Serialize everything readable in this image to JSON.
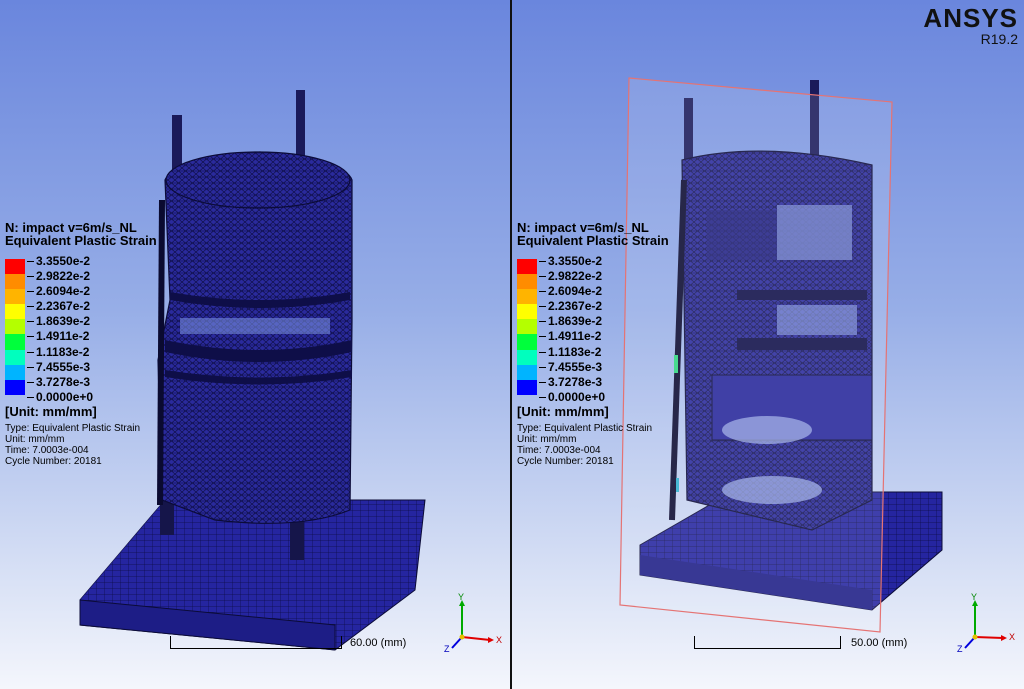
{
  "left_view": {
    "title": "N: impact v=6m/s_NL",
    "subtitle": "Equivalent Plastic Strain",
    "unit": "[Unit: mm/mm]",
    "info": [
      "Type: Equivalent Plastic Strain",
      "Unit: mm/mm",
      "Time: 7.0003e-004",
      "Cycle Number: 20181"
    ],
    "scale_label": "60.00  (mm)"
  },
  "right_view": {
    "title": "N: impact v=6m/s_NL",
    "subtitle": "Equivalent Plastic Strain",
    "unit": "[Unit: mm/mm]",
    "info": [
      "Type: Equivalent Plastic Strain",
      "Unit: mm/mm",
      "Time: 7.0003e-004",
      "Cycle Number: 20181"
    ],
    "scale_label": "50.00  (mm)"
  },
  "legend_values": [
    "3.3550e-2",
    "2.9822e-2",
    "2.6094e-2",
    "2.2367e-2",
    "1.8639e-2",
    "1.4911e-2",
    "1.1183e-2",
    "7.4555e-3",
    "3.7278e-3",
    "0.0000e+0"
  ],
  "legend_colors": [
    "#ff0000",
    "#ff8c00",
    "#ffb400",
    "#ffff00",
    "#b4ff00",
    "#00ff3c",
    "#00ffbe",
    "#00b4ff",
    "#0000ff"
  ],
  "triad": {
    "x": "X",
    "y": "Y",
    "z": "Z"
  },
  "logo": {
    "brand": "ANSYS",
    "version": "R19.2"
  },
  "colors": {
    "mesh": "#2c2c9e",
    "mesh_dark": "#151560",
    "section_plane": "#e57373"
  }
}
